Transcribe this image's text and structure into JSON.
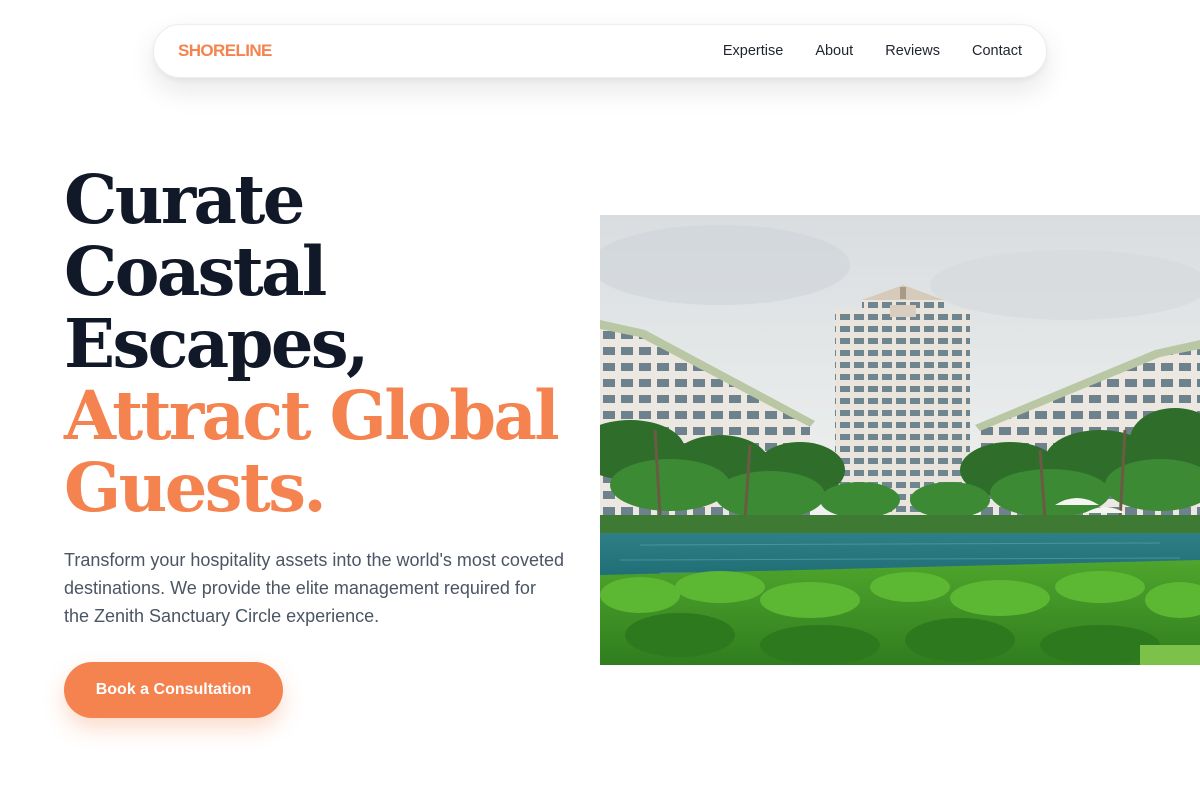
{
  "brand": {
    "name": "SHORELINE"
  },
  "nav": {
    "links": [
      "Expertise",
      "About",
      "Reviews",
      "Contact"
    ]
  },
  "hero": {
    "title_lines": [
      "Curate",
      "Coastal",
      "Escapes,"
    ],
    "accent_lines": [
      "Attract Global",
      "Guests."
    ],
    "subtitle": "Transform your hospitality assets into the world's most coveted destinations. We provide the elite management required for the Zenith Sanctuary Circle experience.",
    "cta_label": "Book a Consultation",
    "image": "resort-hotel-pool-photo"
  },
  "colors": {
    "accent": "#f4834f",
    "heading": "#111827",
    "body_text": "#4b5563",
    "background": "#ffffff"
  }
}
